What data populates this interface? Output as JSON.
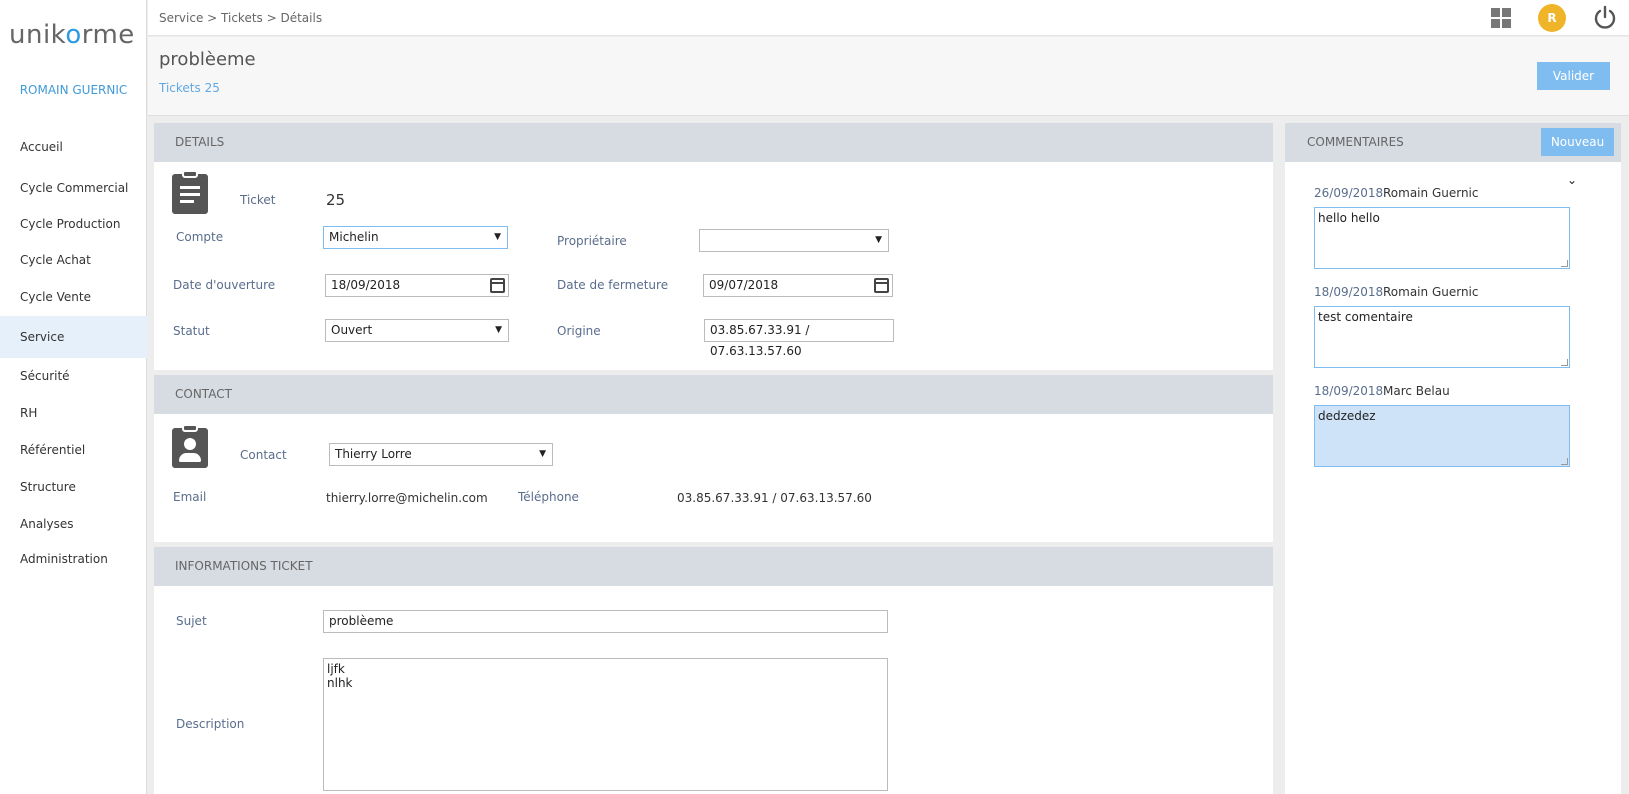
{
  "sidebar": {
    "logo": "unikorme",
    "user": "ROMAIN GUERNIC",
    "items": [
      {
        "label": "Accueil"
      },
      {
        "label": "Cycle Commercial"
      },
      {
        "label": "Cycle Production"
      },
      {
        "label": "Cycle Achat"
      },
      {
        "label": "Cycle Vente"
      },
      {
        "label": "Service"
      },
      {
        "label": "Sécurité"
      },
      {
        "label": "RH"
      },
      {
        "label": "Référentiel"
      },
      {
        "label": "Structure"
      },
      {
        "label": "Analyses"
      },
      {
        "label": "Administration"
      }
    ],
    "active": "Service"
  },
  "topbar": {
    "breadcrumb": "Service > Tickets > Détails",
    "avatar": "R",
    "icons": [
      "grid-icon",
      "power-icon"
    ]
  },
  "header": {
    "title": "problèeme",
    "subtitle": "Tickets 25",
    "validate_label": "Valider"
  },
  "details": {
    "heading": "DETAILS",
    "ticket_label": "Ticket",
    "ticket_value": "25",
    "compte_label": "Compte",
    "compte_value": "Michelin",
    "proprietaire_label": "Propriétaire",
    "proprietaire_value": "",
    "date_ouverture_label": "Date d'ouverture",
    "date_ouverture_value": "18/09/2018",
    "date_fermeture_label": "Date de fermeture",
    "date_fermeture_value": "09/07/2018",
    "statut_label": "Statut",
    "statut_value": "Ouvert",
    "origine_label": "Origine",
    "origine_value": "03.85.67.33.91 / 07.63.13.57.60"
  },
  "contact": {
    "heading": "CONTACT",
    "contact_label": "Contact",
    "contact_value": "Thierry Lorre",
    "email_label": "Email",
    "email_value": "thierry.lorre@michelin.com",
    "telephone_label": "Téléphone",
    "telephone_value": "03.85.67.33.91 / 07.63.13.57.60"
  },
  "info": {
    "heading": "INFORMATIONS TICKET",
    "sujet_label": "Sujet",
    "sujet_value": "problèeme",
    "description_label": "Description",
    "description_value": "ljfk\nnlhk"
  },
  "comments": {
    "heading": "COMMENTAIRES",
    "new_label": "Nouveau",
    "items": [
      {
        "date": "26/09/2018",
        "author": "Romain Guernic",
        "text": "hello hello"
      },
      {
        "date": "18/09/2018",
        "author": "Romain Guernic",
        "text": "test comentaire"
      },
      {
        "date": "18/09/2018",
        "author": "Marc Belau",
        "text": "dedzedez"
      }
    ]
  },
  "colors": {
    "accent": "#7fbdf1",
    "section_header": "#d7dbe2",
    "avatar": "#f0b429",
    "link": "#3f9ad8"
  }
}
